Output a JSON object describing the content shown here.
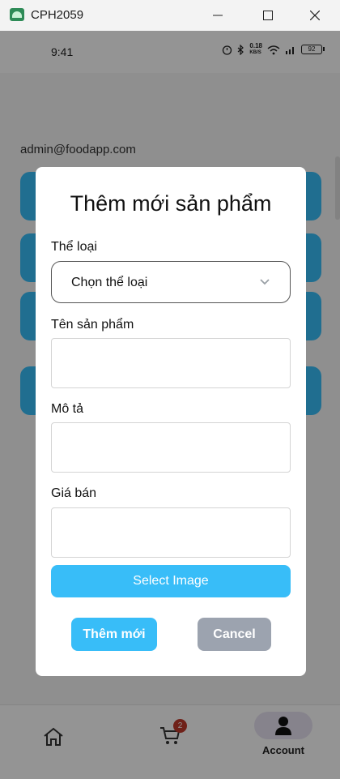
{
  "window": {
    "title": "CPH2059"
  },
  "status_bar": {
    "time": "9:41",
    "net_speed": "0.18",
    "net_unit": "KB/S",
    "battery": "92"
  },
  "screen": {
    "email": "admin@foodapp.com"
  },
  "dialog": {
    "title": "Thêm mới sản phẩm",
    "category_label": "Thể loại",
    "category_value": "Chọn thể loại",
    "name_label": "Tên sản phẩm",
    "name_value": "",
    "desc_label": "Mô tả",
    "desc_value": "",
    "price_label": "Giá bán",
    "price_value": "",
    "select_image_label": "Select Image",
    "add_label": "Thêm mới",
    "cancel_label": "Cancel"
  },
  "bottom_nav": {
    "cart_badge": "2",
    "account_label": "Account"
  },
  "colors": {
    "accent": "#38bdf8",
    "cancel": "#9ca3af",
    "badge": "#c0392b"
  }
}
